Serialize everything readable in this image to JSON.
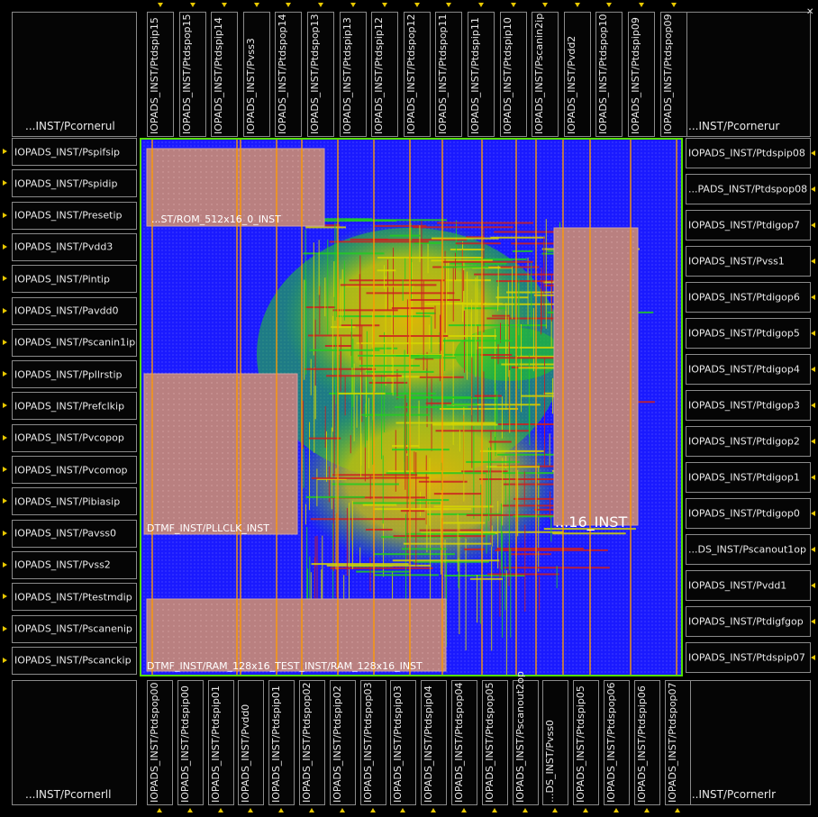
{
  "corners": {
    "ul": "...INST/Pcornerul",
    "ur": "...INST/Pcornerur",
    "ll": "...INST/Pcornerll",
    "lr": "...INST/Pcornerlr"
  },
  "pads_left": [
    "IOPADS_INST/Pspifsip",
    "IOPADS_INST/Pspidip",
    "IOPADS_INST/Presetip",
    "IOPADS_INST/Pvdd3",
    "IOPADS_INST/Pintip",
    "IOPADS_INST/Pavdd0",
    "IOPADS_INST/Pscanin1ip",
    "IOPADS_INST/Ppllrstip",
    "IOPADS_INST/Prefclkip",
    "IOPADS_INST/Pvcopop",
    "IOPADS_INST/Pvcomop",
    "IOPADS_INST/Pibiasip",
    "IOPADS_INST/Pavss0",
    "IOPADS_INST/Pvss2",
    "IOPADS_INST/Ptestmdip",
    "IOPADS_INST/Pscanenip",
    "IOPADS_INST/Pscanckip"
  ],
  "pads_right": [
    "IOPADS_INST/Ptdspip08",
    "...PADS_INST/Ptdspop08",
    "IOPADS_INST/Ptdigop7",
    "IOPADS_INST/Pvss1",
    "IOPADS_INST/Ptdigop6",
    "IOPADS_INST/Ptdigop5",
    "IOPADS_INST/Ptdigop4",
    "IOPADS_INST/Ptdigop3",
    "IOPADS_INST/Ptdigop2",
    "IOPADS_INST/Ptdigop1",
    "IOPADS_INST/Ptdigop0",
    "...DS_INST/Pscanout1op",
    "IOPADS_INST/Pvdd1",
    "IOPADS_INST/Ptdigfgop",
    "IOPADS_INST/Ptdspip07"
  ],
  "pads_top": [
    "IOPADS_INST/Ptdspip15",
    "IOPADS_INST/Ptdspop15",
    "IOPADS_INST/Ptdspip14",
    "IOPADS_INST/Pvss3",
    "IOPADS_INST/Ptdspop14",
    "IOPADS_INST/Ptdspop13",
    "IOPADS_INST/Ptdspip13",
    "IOPADS_INST/Ptdspip12",
    "IOPADS_INST/Ptdspop12",
    "IOPADS_INST/Ptdspop11",
    "IOPADS_INST/Ptdspip11",
    "IOPADS_INST/Ptdspip10",
    "IOPADS_INST/Pscanin2ip",
    "IOPADS_INST/Pvdd2",
    "IOPADS_INST/Ptdspop10",
    "IOPADS_INST/Ptdspip09",
    "IOPADS_INST/Ptdspop09"
  ],
  "pads_bottom": [
    "IOPADS_INST/Ptdspop00",
    "IOPADS_INST/Ptdspip00",
    "IOPADS_INST/Ptdspip01",
    "IOPADS_INST/Pvdd0",
    "IOPADS_INST/Ptdspip01",
    "IOPADS_INST/Ptdspop02",
    "IOPADS_INST/Ptdspip02",
    "IOPADS_INST/Ptdspop03",
    "IOPADS_INST/Ptdspip03",
    "IOPADS_INST/Ptdspip04",
    "IOPADS_INST/Ptdspop04",
    "IOPADS_INST/Ptdspop05",
    "IOPADS_INST/Pscanout2op",
    "...DS_INST/Pvss0",
    "IOPADS_INST/Ptdspip05",
    "IOPADS_INST/Ptdspop06",
    "IOPADS_INST/Ptdspip06",
    "IOPADS_INST/Ptdspop07"
  ],
  "macros": {
    "rom": "...ST/ROM_512x16_0_INST",
    "pll": "DTMF_INST/PLLCLK_INST",
    "ram_bottom": "DTMF_INST/RAM_128x16_TEST_INST/RAM_128x16_INST",
    "ram_right": "...16_INST"
  },
  "colors": {
    "background": "#000000",
    "core_fill": "#1a1aff",
    "macro_fill": "#b98080",
    "power_stripe": "#ff9a00",
    "routing_green": "#22cc22",
    "routing_yellow": "#d6d600",
    "routing_red": "#cc2020",
    "core_border": "#55dd00",
    "pin": "#e8c800"
  }
}
